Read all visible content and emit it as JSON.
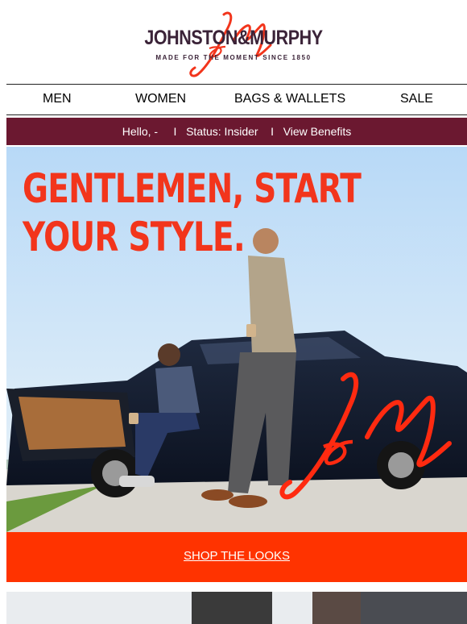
{
  "brand": {
    "name": "JOHNSTON&MURPHY",
    "tagline": "MADE FOR THE MOMENT SINCE 1850",
    "color_primary": "#3b2338",
    "color_accent": "#f2351c"
  },
  "nav": {
    "items": [
      {
        "label": "MEN"
      },
      {
        "label": "WOMEN"
      },
      {
        "label": "BAGS & WALLETS"
      },
      {
        "label": "SALE"
      }
    ]
  },
  "status_bar": {
    "text": "Hello, -     I   Status: Insider    I   View Benefits",
    "background": "#6b1830"
  },
  "hero": {
    "headline_line1": "GENTLEMEN, START",
    "headline_line2": "YOUR STYLE.",
    "image_alt": "two-men-with-classic-car"
  },
  "cta": {
    "label": "SHOP THE LOOKS",
    "background": "#ff3300"
  }
}
